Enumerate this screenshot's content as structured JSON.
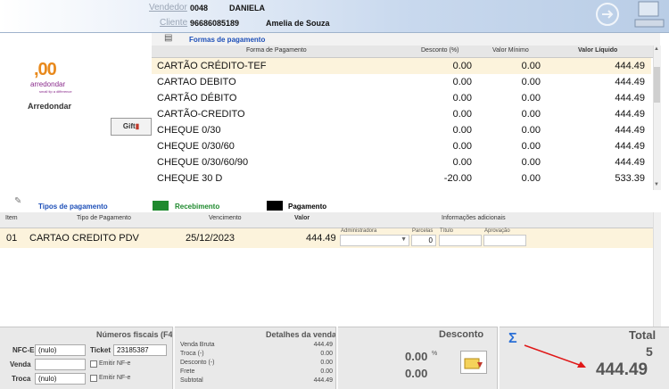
{
  "header": {
    "vendedor_label": "Vendedor",
    "vendedor_code": "0048",
    "vendedor_name": "DANIELA",
    "cliente_label": "Cliente",
    "cliente_code": "96686085189",
    "cliente_name": "Amelia de Souza"
  },
  "logo": {
    "mark": ",00",
    "brand": "arredondar",
    "tagline": "small tip a difference",
    "label": "Arredondar",
    "gift_label": "Gift"
  },
  "formas": {
    "title": "Formas de pagamento",
    "columns": [
      "Forma de Pagamento",
      "Desconto (%)",
      "Valor Mínimo",
      "Valor Líquido"
    ],
    "rows": [
      {
        "name": "CARTÃO CRÉDITO-TEF",
        "desconto": "0.00",
        "minimo": "0.00",
        "liquido": "444.49"
      },
      {
        "name": "CARTAO DEBITO",
        "desconto": "0.00",
        "minimo": "0.00",
        "liquido": "444.49"
      },
      {
        "name": "CARTÃO DÉBITO",
        "desconto": "0.00",
        "minimo": "0.00",
        "liquido": "444.49"
      },
      {
        "name": "CARTÃO-CREDITO",
        "desconto": "0.00",
        "minimo": "0.00",
        "liquido": "444.49"
      },
      {
        "name": "CHEQUE 0/30",
        "desconto": "0.00",
        "minimo": "0.00",
        "liquido": "444.49"
      },
      {
        "name": "CHEQUE 0/30/60",
        "desconto": "0.00",
        "minimo": "0.00",
        "liquido": "444.49"
      },
      {
        "name": "CHEQUE 0/30/60/90",
        "desconto": "0.00",
        "minimo": "0.00",
        "liquido": "444.49"
      },
      {
        "name": "CHEQUE 30 D",
        "desconto": "-20.00",
        "minimo": "0.00",
        "liquido": "533.39"
      }
    ]
  },
  "legend": {
    "tipos": "Tipos de pagamento",
    "recebimento": "Recebimento",
    "pagamento": "Pagamento",
    "recebimento_color": "#1f8a2e",
    "pagamento_color": "#000000"
  },
  "items": {
    "columns": {
      "item": "Item",
      "tipo": "Tipo de Pagamento",
      "vencimento": "Vencimento",
      "valor": "Valor",
      "info": "Informações adicionais"
    },
    "rows": [
      {
        "item": "01",
        "tipo": "CARTAO CREDITO PDV",
        "vencimento": "25/12/2023",
        "valor": "444.49"
      }
    ],
    "extra": {
      "administradora_label": "Administradora",
      "parcelas_label": "Parcelas",
      "parcelas_value": "0",
      "titulo_label": "Título",
      "aprovacao_label": "Aprovação"
    }
  },
  "fiscais": {
    "title": "Números fiscais (F4)",
    "nfce_label": "NFC-E",
    "nfce_value": "(nulo)",
    "ticket_label": "Ticket",
    "ticket_value": "23185387",
    "venda_label": "Venda",
    "troca_label": "Troca",
    "troca_value": "(nulo)",
    "emitir1": "Emitir NF-e",
    "emitir2": "Emitir NF-e"
  },
  "detalhes": {
    "title": "Detalhes da venda",
    "rows": [
      {
        "label": "Venda Bruta",
        "value": "444.49"
      },
      {
        "label": "Troca (-)",
        "value": "0.00"
      },
      {
        "label": "Desconto (-)",
        "value": "0.00"
      },
      {
        "label": "Frete",
        "value": "0.00"
      },
      {
        "label": "Subtotal",
        "value": "444.49"
      }
    ]
  },
  "desconto": {
    "title": "Desconto",
    "percent": "0.00",
    "percent_sign": "%",
    "value": "0.00"
  },
  "total": {
    "title": "Total",
    "count": "5",
    "amount": "444.49"
  }
}
